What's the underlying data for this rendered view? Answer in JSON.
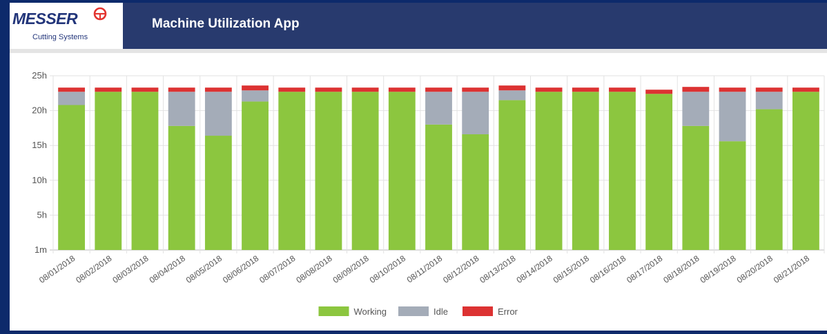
{
  "header": {
    "logo_text": "MESSER",
    "logo_subtext": "Cutting Systems",
    "title": "Machine Utilization App"
  },
  "colors": {
    "working": "#8cc63f",
    "idle": "#a4acb8",
    "error": "#dc3232",
    "header_bg": "#283a6e",
    "logo_blue": "#22357a",
    "logo_red": "#e3342f"
  },
  "chart_data": {
    "type": "bar",
    "stacked": true,
    "categories": [
      "08/01/2018",
      "08/02/2018",
      "08/03/2018",
      "08/04/2018",
      "08/05/2018",
      "08/06/2018",
      "08/07/2018",
      "08/08/2018",
      "08/09/2018",
      "08/10/2018",
      "08/11/2018",
      "08/12/2018",
      "08/13/2018",
      "08/14/2018",
      "08/15/2018",
      "08/16/2018",
      "08/17/2018",
      "08/18/2018",
      "08/19/2018",
      "08/20/2018",
      "08/21/2018"
    ],
    "series": [
      {
        "name": "Working",
        "color": "#8cc63f",
        "values": [
          20.8,
          22.7,
          22.7,
          17.8,
          16.4,
          21.3,
          22.7,
          22.7,
          22.7,
          22.7,
          18.0,
          16.6,
          21.5,
          22.7,
          22.7,
          22.7,
          22.4,
          17.8,
          15.6,
          20.2,
          22.7
        ]
      },
      {
        "name": "Idle",
        "color": "#a4acb8",
        "values": [
          1.9,
          0,
          0,
          4.9,
          6.3,
          1.6,
          0,
          0,
          0,
          0,
          4.7,
          6.1,
          1.4,
          0,
          0,
          0,
          0,
          4.9,
          7.1,
          2.5,
          0
        ]
      },
      {
        "name": "Error",
        "color": "#dc3232",
        "values": [
          0.6,
          0.6,
          0.6,
          0.6,
          0.6,
          0.7,
          0.6,
          0.6,
          0.6,
          0.6,
          0.6,
          0.6,
          0.7,
          0.6,
          0.6,
          0.6,
          0.6,
          0.7,
          0.6,
          0.6,
          0.6
        ]
      }
    ],
    "y_ticks": [
      "1m",
      "5h",
      "10h",
      "15h",
      "20h",
      "25h"
    ],
    "y_tick_values": [
      0,
      5,
      10,
      15,
      20,
      25
    ],
    "ylim": [
      0,
      25
    ],
    "grid": true,
    "legend_position": "bottom-center"
  }
}
